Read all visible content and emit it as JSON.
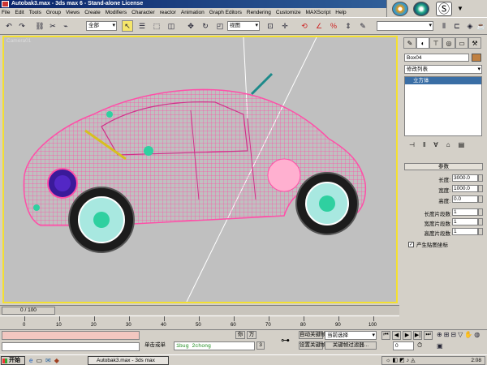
{
  "window": {
    "title": "Autobak3.max - 3ds max 6 - Stand-alone License"
  },
  "menu": [
    "File",
    "Edit",
    "Tools",
    "Group",
    "Views",
    "Create",
    "Modifiers",
    "Character",
    "reactor",
    "Animation",
    "Graph Editors",
    "Rendering",
    "Customize",
    "MAXScript",
    "Help"
  ],
  "toolbar": {
    "selection_filter": "全部",
    "ref_coord": "视图"
  },
  "viewport": {
    "label": "Camera01",
    "colors": {
      "wire": "#ff5fae",
      "accent": "#f4e030"
    }
  },
  "command_panel": {
    "object_name": "Box04",
    "modifier_list": "修改列表",
    "stack_item": "立方体",
    "rollout_title": "参数",
    "params": [
      {
        "label": "长度:",
        "value": "3000.0"
      },
      {
        "label": "宽度:",
        "value": "1000.0"
      },
      {
        "label": "高度:",
        "value": "0.0"
      },
      {
        "label": "长度片段数",
        "value": "1"
      },
      {
        "label": "宽度片段数",
        "value": "1"
      },
      {
        "label": "高度片段数",
        "value": "1"
      }
    ],
    "checkbox_label": "产生贴图坐标"
  },
  "timeline": {
    "slider_label": "0 / 100",
    "ticks": [
      "0",
      "10",
      "20",
      "30",
      "40",
      "50",
      "60",
      "70",
      "80",
      "90",
      "100"
    ]
  },
  "status": {
    "prompt": "单击或单",
    "script_output": "1bug 2chong",
    "small_btn_a": "你",
    "small_btn_b": "万",
    "small_btn_c": "3",
    "autokey": "自动关键帧",
    "setkey": "设置关键帧",
    "selection_combo": "当前选择",
    "keyfilter": "关键帧过滤器...",
    "frame_value": "0"
  },
  "taskbar": {
    "start": "开始",
    "task": "Autobak3.max - 3ds max",
    "clock": "2:08"
  }
}
